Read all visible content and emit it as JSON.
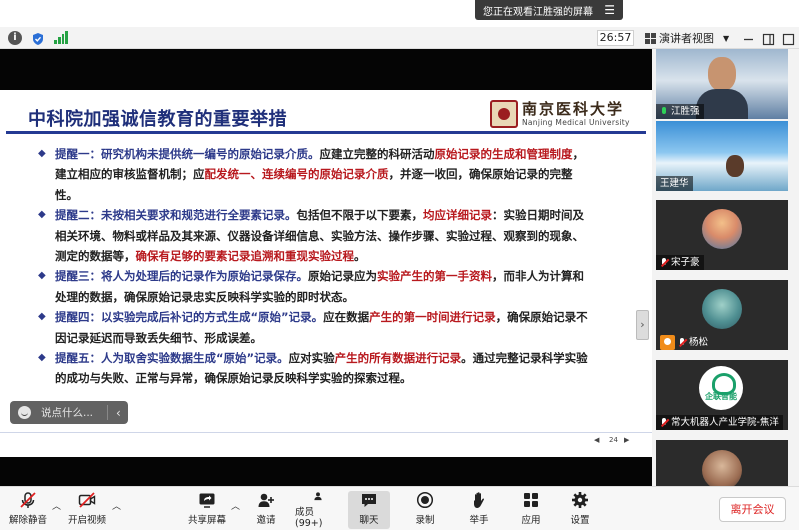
{
  "banner": {
    "text": "您正在观看江胜强的屏幕"
  },
  "topbar": {
    "timer": "26:57",
    "view_label": "演讲者视图"
  },
  "slide": {
    "title": "中科院加强诚信教育的重要举措",
    "logo_cn": "南京医科大学",
    "logo_en": "Nanjing Medical University",
    "items": [
      {
        "lead": "提醒一：研究机构未提供统一编号的原始记录介质。",
        "body1": "应建立完整的科研活动",
        "red1": "原始记录的生成和管理制度",
        "body2": "，建立相应的审核监督机制；应",
        "red2": "配发统一、连续编号的原始记录介质",
        "body3": "，并逐一收回，确保原始记录的完整性。"
      },
      {
        "lead": "提醒二：未按相关要求和规范进行全要素记录。",
        "body1": "包括但不限于以下要素，",
        "red1": "均应详细记录",
        "body2": "：实验日期时间及相关环境、物料或样品及其来源、仪器设备详细信息、实验方法、操作步骤、实验过程、观察到的现象、测定的数据等，",
        "red2": "确保有足够的要素记录追溯和重现实验过程",
        "body3": "。"
      },
      {
        "lead": "提醒三：将人为处理后的记录作为原始记录保存。",
        "body1": "原始记录应为",
        "red1": "实验产生的第一手资料",
        "body2": "，而非人为计算和处理的数据，确保原始记录忠实反映科学实验的即时状态。",
        "red2": "",
        "body3": ""
      },
      {
        "lead": "提醒四：以实验完成后补记的方式生成“原始”记录。",
        "body1": "应在数据",
        "red1": "产生的第一时间进行记录",
        "body2": "，确保原始记录不因记录延迟而导致丢失细节、形成误差。",
        "red2": "",
        "body3": ""
      },
      {
        "lead": "提醒五：人为取舍实验数据生成“原始”记录。",
        "body1": "应对实验",
        "red1": "产生的所有数据进行记录",
        "body2": "。通过完整记录科学实验的成功与失败、正常与异常，确保原始记录反映科学实验的探索过程。",
        "red2": "",
        "body3": ""
      }
    ],
    "page_number": "24",
    "page_prev": "◀",
    "page_next": "▶"
  },
  "chat_pill": {
    "placeholder": "说点什么..."
  },
  "participants": [
    {
      "name": "江胜强",
      "mic": "on"
    },
    {
      "name": "王建华",
      "mic": "none"
    },
    {
      "name": "宋子豪",
      "mic": "off"
    },
    {
      "name": "杨松",
      "mic": "off"
    },
    {
      "name": "常大机器人产业学院-焦洋",
      "mic": "off",
      "badge_text": "企联智能"
    },
    {
      "name": "",
      "mic": "none"
    }
  ],
  "toolbar": {
    "unmute": "解除静音",
    "video": "开启视频",
    "share": "共享屏幕",
    "invite": "邀请",
    "members": "成员(99+)",
    "chat": "聊天",
    "record": "录制",
    "raise_hand": "举手",
    "apps": "应用",
    "settings": "设置",
    "leave": "离开会议"
  },
  "colors": {
    "title_blue": "#1f2f7a",
    "accent_red": "#b8191e",
    "rule_blue": "#243a93",
    "leave_red": "#d22222"
  }
}
